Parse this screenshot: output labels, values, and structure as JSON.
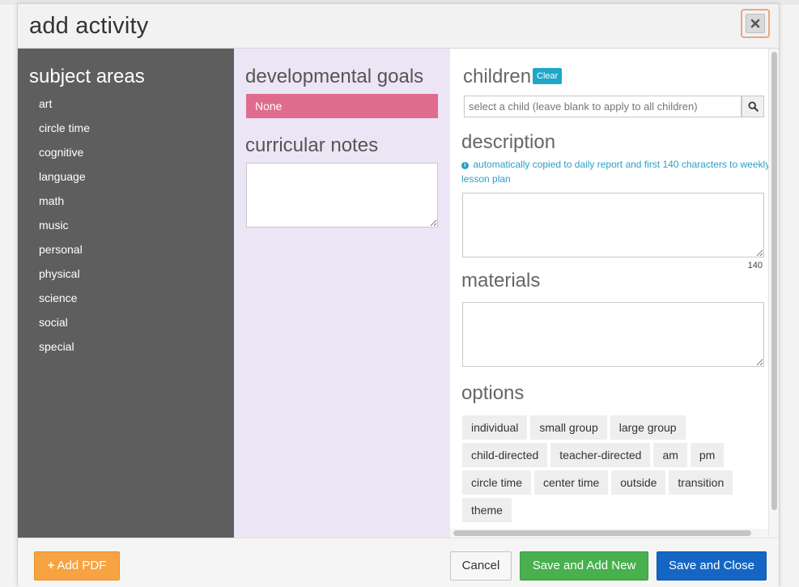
{
  "modal": {
    "title": "add activity",
    "close_icon": "close-icon"
  },
  "subjects": {
    "heading": "subject areas",
    "items": [
      "art",
      "circle time",
      "cognitive",
      "language",
      "math",
      "music",
      "personal",
      "physical",
      "science",
      "social",
      "special"
    ]
  },
  "goals": {
    "heading": "developmental goals",
    "selected": "None",
    "notes_heading": "curricular notes",
    "notes_value": ""
  },
  "children": {
    "heading": "children",
    "clear_label": "Clear",
    "placeholder": "select a child (leave blank to apply to all children)",
    "search_icon": "search-icon"
  },
  "description": {
    "heading": "description",
    "help_text": "automatically copied to daily report and first 140 characters to weekly lesson plan",
    "value": "",
    "char_count": "140"
  },
  "materials": {
    "heading": "materials",
    "value": ""
  },
  "options": {
    "heading": "options",
    "rows": [
      [
        "individual",
        "small group",
        "large group"
      ],
      [
        "child-directed",
        "teacher-directed",
        "am",
        "pm"
      ],
      [
        "circle time",
        "center time",
        "outside",
        "transition"
      ],
      [
        "theme"
      ]
    ]
  },
  "footer": {
    "add_pdf_label": "Add PDF",
    "cancel_label": "Cancel",
    "save_new_label": "Save and Add New",
    "save_close_label": "Save and Close"
  },
  "colors": {
    "subjects_bg": "#5e5e5e",
    "goals_bg": "#ece5f5",
    "goal_selected": "#df6c8c",
    "clear_badge": "#1fa7c9",
    "add_pdf": "#f7a341",
    "save_new": "#48b04e",
    "save_close": "#1566c4"
  }
}
